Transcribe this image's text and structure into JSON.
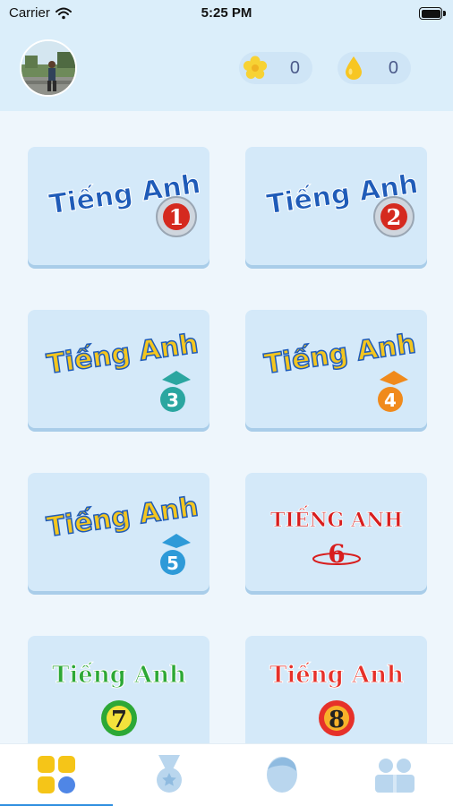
{
  "status_bar": {
    "carrier": "Carrier",
    "time": "5:25 PM"
  },
  "header": {
    "flower_count": "0",
    "drop_count": "0"
  },
  "books": [
    {
      "title": "Tiếng Anh",
      "number": "1",
      "style": "blue-disc",
      "badge_color": "#d52a1f"
    },
    {
      "title": "Tiếng Anh",
      "number": "2",
      "style": "blue-disc",
      "badge_color": "#d52a1f"
    },
    {
      "title": "Tiếng Anh",
      "number": "3",
      "style": "yellow-apple",
      "badge_color": "#2ba6a0"
    },
    {
      "title": "Tiếng Anh",
      "number": "4",
      "style": "yellow-apple",
      "badge_color": "#f08a1c"
    },
    {
      "title": "Tiếng Anh",
      "number": "5",
      "style": "yellow-apple",
      "badge_color": "#2e9ad8"
    },
    {
      "title": "TIẾNG ANH",
      "number": "6",
      "style": "red-caps",
      "badge_color": "#d81e1e"
    },
    {
      "title": "Tiếng Anh",
      "number": "7",
      "style": "green-ball",
      "badge_color": "#2da836"
    },
    {
      "title": "Tiếng Anh",
      "number": "8",
      "style": "red-ball",
      "badge_color": "#e6312a"
    }
  ],
  "tabs": [
    {
      "name": "tab-books",
      "icon": "grid-icon",
      "active": true
    },
    {
      "name": "tab-achievements",
      "icon": "medal-icon",
      "active": false
    },
    {
      "name": "tab-profile",
      "icon": "user-icon",
      "active": false
    },
    {
      "name": "tab-community",
      "icon": "group-icon",
      "active": false
    }
  ],
  "colors": {
    "header_bg": "#dbeefa",
    "card_bg": "#d4e9f9",
    "accent": "#2f8fe0",
    "counter_text": "#4b5a8a"
  }
}
